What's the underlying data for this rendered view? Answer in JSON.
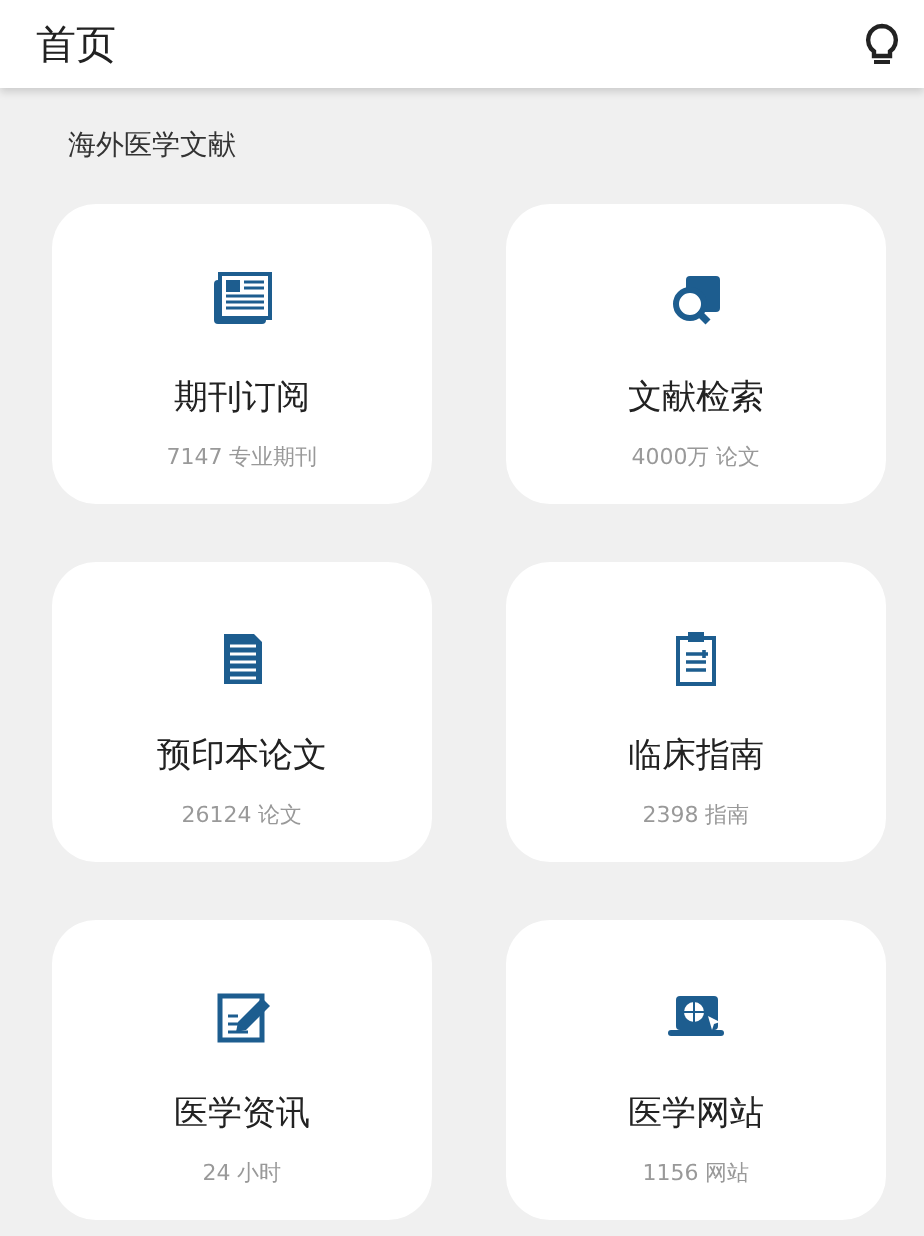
{
  "header": {
    "title": "首页"
  },
  "section": {
    "title": "海外医学文献"
  },
  "cards": [
    {
      "title": "期刊订阅",
      "subtitle": "7147 专业期刊"
    },
    {
      "title": "文献检索",
      "subtitle": "4000万 论文"
    },
    {
      "title": "预印本论文",
      "subtitle": "26124 论文"
    },
    {
      "title": "临床指南",
      "subtitle": "2398 指南"
    },
    {
      "title": "医学资讯",
      "subtitle": "24 小时"
    },
    {
      "title": "医学网站",
      "subtitle": "1156 网站"
    }
  ]
}
